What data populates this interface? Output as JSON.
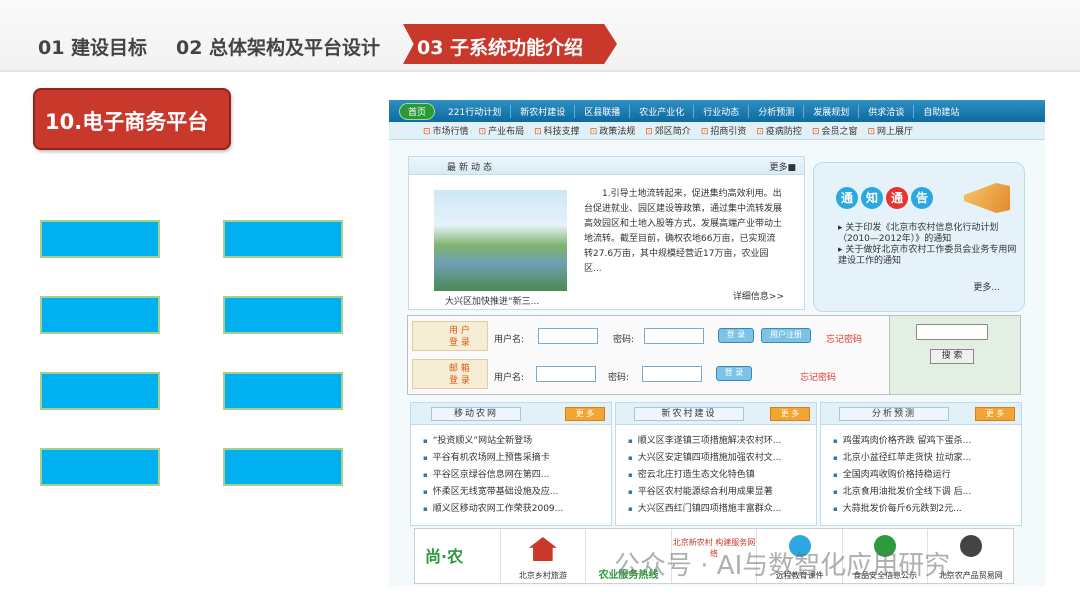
{
  "tabs": {
    "t1": "01  建设目标",
    "t2": "02 总体架构及平台设计",
    "t3": "03  子系统功能介绍"
  },
  "section_title": "10.电子商务平台",
  "colors": {
    "accent": "#c8382b",
    "box": "#00b0f0"
  },
  "site": {
    "nav1": [
      "首页",
      "221行动计划",
      "新农村建设",
      "区县联播",
      "农业产业化",
      "行业动态",
      "分析预测",
      "发展规划",
      "供求洽谈",
      "自助建站"
    ],
    "nav2": [
      "市场行情",
      "产业布局",
      "科技支撑",
      "政策法规",
      "郊区简介",
      "招商引资",
      "疫病防控",
      "会员之窗",
      "网上展厅"
    ],
    "news": {
      "title": "最新动态",
      "more": "更多",
      "caption": "大兴区加快推进“新三...",
      "text": "1.引导土地流转起来，促进集约高效利用。出台促进就业、园区建设等政策，通过集中流转发展高效园区和土地入股等方式，发展高端产业带动土地流转。截至目前，确权农地66万亩，已实现流转27.6万亩，其中规模经营近17万亩，农业园区...",
      "detail": "详细信息>>"
    },
    "notice": {
      "title": [
        "通",
        "知",
        "通",
        "告"
      ],
      "items": [
        "▸ 关于印发《北京市农村信息化行动计划（2010—2012年）》的通知",
        "▸ 关于做好北京市农村工作委员会业务专用网建设工作的通知"
      ],
      "more": "更多..."
    },
    "login": {
      "user_badge": "用 户\n登 录",
      "mail_badge": "邮 箱\n登 录",
      "username": "用户名:",
      "password": "密码:",
      "login_btn": "登 录",
      "register_btn": "用户注册",
      "forgot": "忘记密码",
      "search_btn": "搜 索"
    },
    "panels": [
      {
        "title": "移动农网",
        "more": "更 多",
        "items": [
          "“投资顺义”网站全新登场",
          "平谷有机农场网上预售采摘卡",
          "平谷区京绿谷信息网在第四...",
          "怀柔区无线宽带基础设施及应...",
          "顺义区移动农网工作荣获2009..."
        ]
      },
      {
        "title": "新农村建设",
        "more": "更 多",
        "items": [
          "顺义区李遂镇三项措施解决农村环...",
          "大兴区安定镇四项措施加强农村文...",
          "密云北庄打造生态文化特色镇",
          "平谷区农村能源综合利用成果显著",
          "大兴区西红门镇四项措施丰富群众..."
        ]
      },
      {
        "title": "分析预测",
        "more": "更 多",
        "items": [
          "鸡蛋鸡肉价格齐跌 留鸡下蛋杀...",
          "北京小盆径红苹走货快 拉动家...",
          "全国肉鸡收购价格持稳运行",
          "北京食用油批发价全线下调 后...",
          "大蒜批发价每斤6元跌到2元..."
        ]
      }
    ],
    "logos": [
      "尚·农",
      "北京乡村旅游",
      "农业服务热线",
      "北京新农村 构建服务网络",
      "远程教育课件",
      "食品安全信息公示",
      "北京农产品贸易网"
    ]
  },
  "watermark": "公众号 · AI与数智化应用研究"
}
